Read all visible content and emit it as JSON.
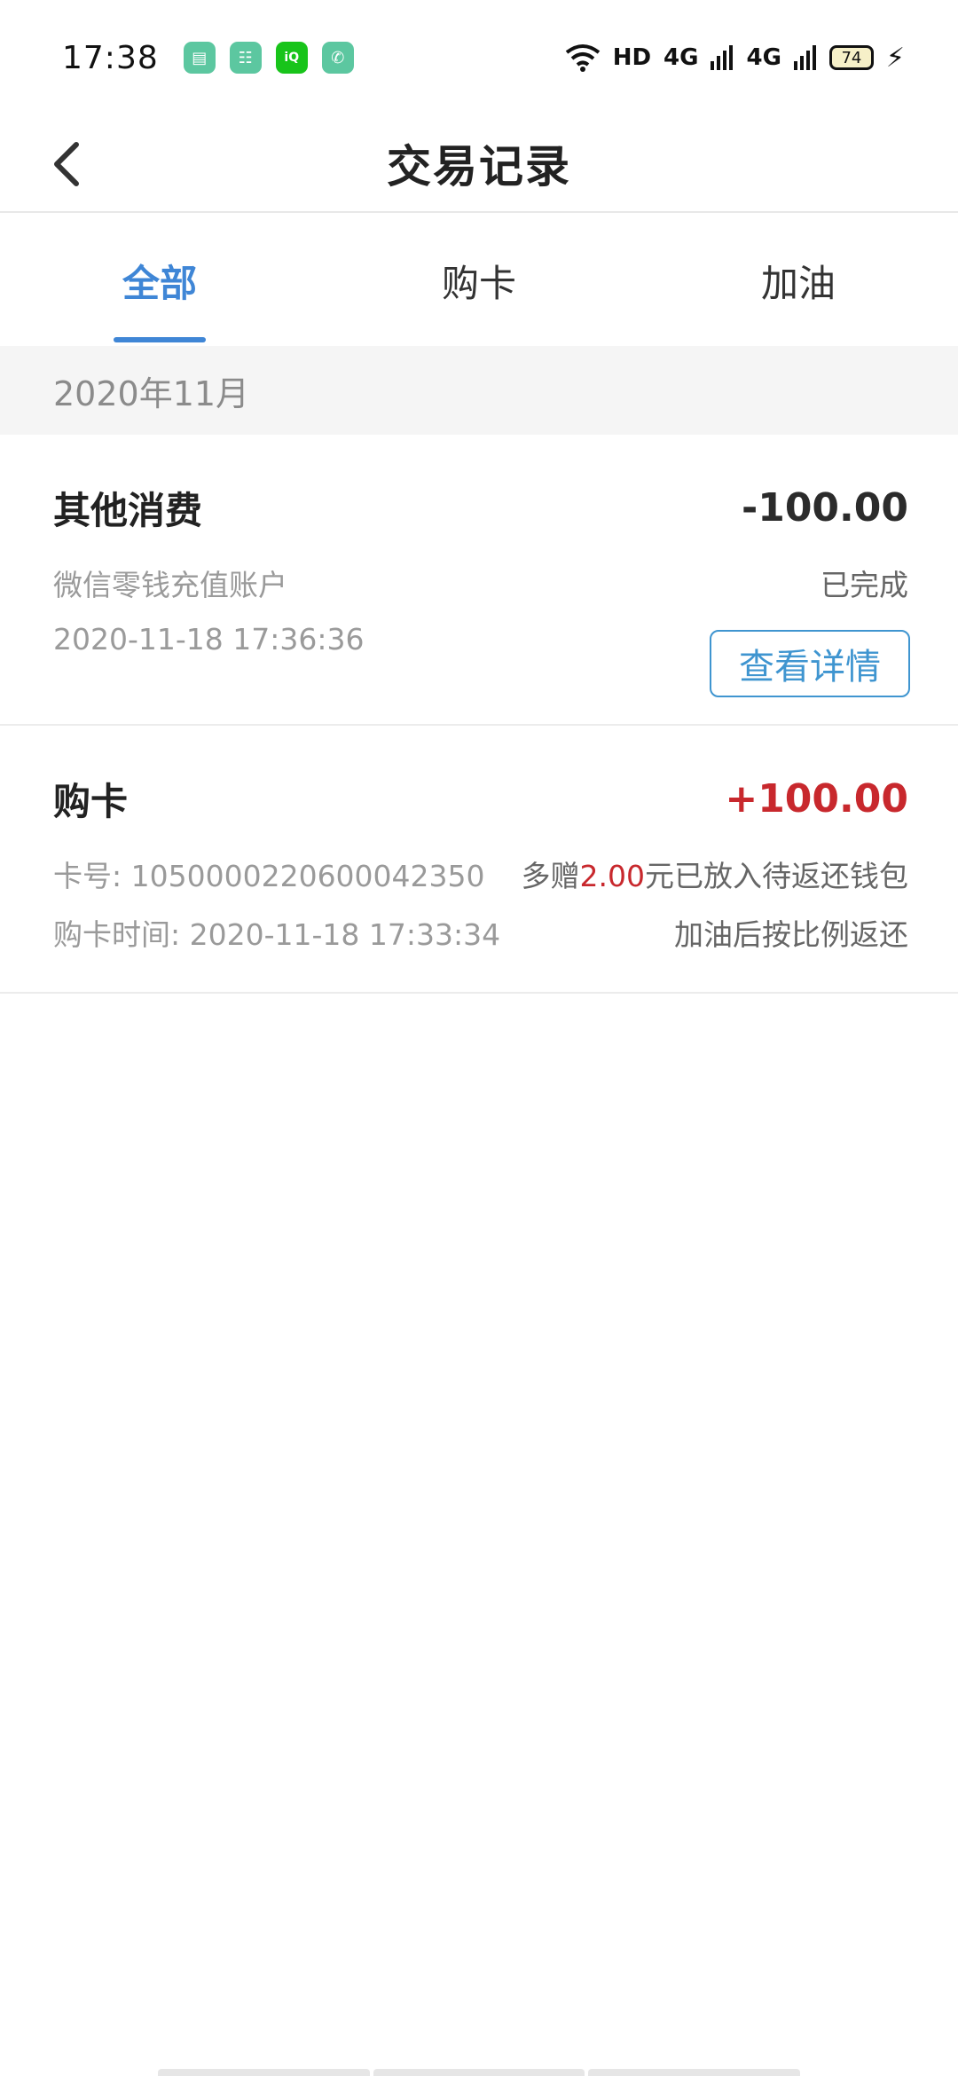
{
  "status_bar": {
    "time": "17:38",
    "apps": [
      {
        "icon": "notes-icon",
        "color": "#5cc7a0",
        "glyph": "▤"
      },
      {
        "icon": "shopping-icon",
        "color": "#5cc7a0",
        "glyph": "☷"
      },
      {
        "icon": "iqiyi-icon",
        "color": "#18c41a",
        "glyph": "iQ"
      },
      {
        "icon": "phone-icon",
        "color": "#5cc7a0",
        "glyph": "✆"
      }
    ],
    "network_hd": "HD",
    "signal_1": "4G",
    "signal_2": "4G",
    "battery": "74"
  },
  "header": {
    "title": "交易记录"
  },
  "tabs": [
    {
      "label": "全部",
      "active": true
    },
    {
      "label": "购卡",
      "active": false
    },
    {
      "label": "加油",
      "active": false
    }
  ],
  "month": "2020年11月",
  "records": [
    {
      "title": "其他消费",
      "amount": "-100.00",
      "account": "微信零钱充值账户",
      "status": "已完成",
      "time": "2020-11-18 17:36:36",
      "detail_label": "查看详情"
    },
    {
      "title": "购卡",
      "amount": "+100.00",
      "card_no": "卡号: 1050000220600042350",
      "purchase_time": "购卡时间: 2020-11-18 17:33:34",
      "bonus_prefix": "多赠",
      "bonus_amount": "2.00",
      "bonus_suffix": "元已放入待返还钱包",
      "bonus_note": "加油后按比例返还"
    }
  ],
  "colors": {
    "accent": "#3f86d6",
    "positive_amount": "#c8282d"
  }
}
